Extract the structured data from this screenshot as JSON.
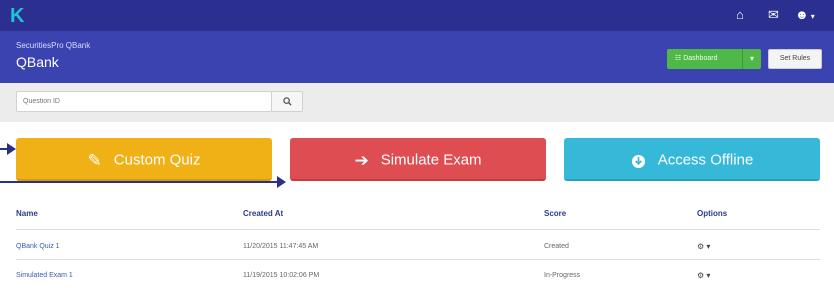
{
  "brand": {
    "logo": "K",
    "subtitle": "SecuritiesPro QBank",
    "title": "QBank"
  },
  "topbar_icons": {
    "home": "home-icon",
    "mail": "mail-icon",
    "user": "user-icon",
    "caret": "▾"
  },
  "header_buttons": {
    "dashboard": "☷ Dashboard",
    "dashboard_caret": "▾",
    "set_rules": "Set Rules"
  },
  "search": {
    "placeholder": "Question ID",
    "button_icon": "search-icon"
  },
  "action_buttons": [
    {
      "label": "Custom Quiz",
      "icon": "pencil-icon",
      "color": "#f0b117"
    },
    {
      "label": "Simulate Exam",
      "icon": "arrow-right-icon",
      "color": "#dd4d52"
    },
    {
      "label": "Access Offline",
      "icon": "download-circle-icon",
      "color": "#36b8d8"
    }
  ],
  "table": {
    "headers": [
      "Name",
      "Created At",
      "Score",
      "Options"
    ],
    "rows": [
      {
        "name": "QBank Quiz 1",
        "created": "11/20/2015 11:47:45 AM",
        "score": "Created",
        "options": "⚙ ▾"
      },
      {
        "name": "Simulated Exam 1",
        "created": "11/19/2015 10:02:06 PM",
        "score": "In-Progress",
        "options": "⚙ ▾"
      }
    ]
  },
  "colors": {
    "topbar": "#2b2f8f",
    "subheader": "#3b43b1",
    "accent_cyan": "#22c2d3",
    "arrow": "#2c2f86"
  }
}
